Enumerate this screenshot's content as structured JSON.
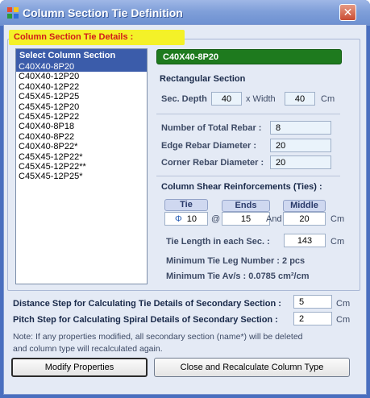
{
  "window": {
    "title": "Column Section Tie Definition",
    "close_glyph": "✕"
  },
  "group": {
    "title": "Column Section Tie Details :"
  },
  "list": {
    "header": "Select Column Section",
    "items": [
      "C40X40-8P20",
      "C40X40-12P20",
      "C40X40-12P22",
      "C45X45-12P25",
      "C45X45-12P20",
      "C45X45-12P22",
      "C40X40-8P18",
      "C40X40-8P22",
      "C40X40-8P22*",
      "C45X45-12P22*",
      "C45X45-12P22**",
      "C45X45-12P25*"
    ],
    "selected_index": 0
  },
  "section": {
    "name": "C40X40-8P20",
    "shape": "Rectangular Section",
    "depth_label": "Sec. Depth",
    "depth": "40",
    "width_label": "x Width",
    "width": "40",
    "unit": "Cm"
  },
  "rebar": {
    "total_label": "Number of Total Rebar :",
    "total": "8",
    "edge_label": "Edge Rebar Diameter :",
    "edge": "20",
    "corner_label": "Corner Rebar Diameter :",
    "corner": "20"
  },
  "shear": {
    "title": "Column Shear Reinforcements (Ties) :",
    "tie_label": "Tie",
    "ends_label": "Ends",
    "middle_label": "Middle",
    "tie_symbol": "Φ",
    "tie": "10",
    "at": "@",
    "ends": "15",
    "and": "And",
    "middle": "20",
    "unit": "Cm",
    "length_label": "Tie Length in each Sec. :",
    "length": "143",
    "min_leg_text": "Minimum Tie Leg Number : 2 pcs",
    "min_av_text": "Minimum Tie  Av/s : 0.0785 cm²/cm"
  },
  "steps": {
    "distance_label": "Distance Step for Calculating Tie Details of Secondary Section :",
    "distance": "5",
    "pitch_label": "Pitch Step for Calculating Spiral Details of Secondary Section :",
    "pitch": "2",
    "unit": "Cm"
  },
  "note": {
    "line1": "Note: If any properties modified, all secondary section (name*) will be deleted",
    "line2": "and column type will recalculated again."
  },
  "buttons": {
    "modify": "Modify Properties",
    "close": "Close and Recalculate Column Type"
  }
}
